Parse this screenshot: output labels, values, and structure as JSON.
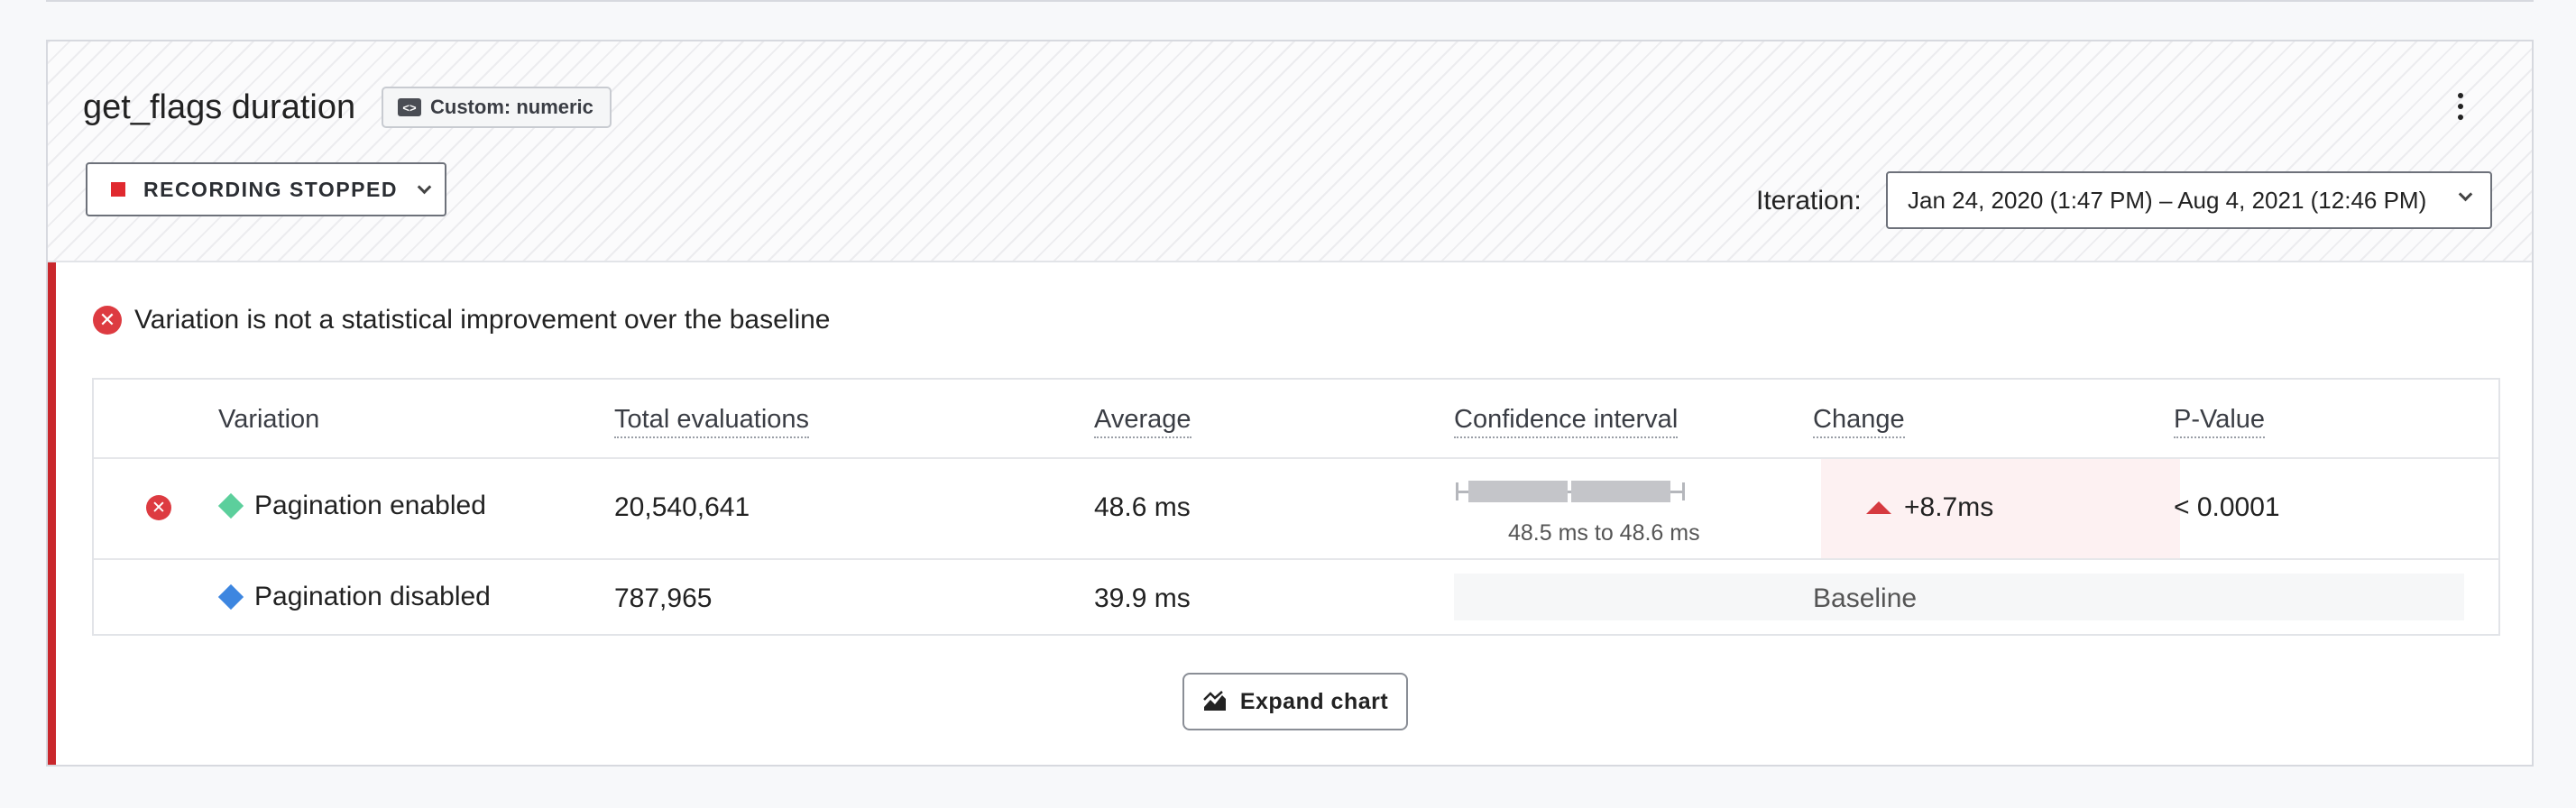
{
  "metric": {
    "title": "get_flags duration",
    "badge": "Custom: numeric",
    "badge_icon": "code-icon"
  },
  "recording": {
    "label": "RECORDING STOPPED",
    "status_color": "#e0292f"
  },
  "iteration": {
    "label": "Iteration:",
    "selected": "Jan 24, 2020 (1:47 PM) – Aug 4, 2021 (12:46 PM)"
  },
  "result": {
    "message": "Variation is not a statistical improvement over the baseline"
  },
  "table": {
    "headers": {
      "variation": "Variation",
      "total": "Total evaluations",
      "average": "Average",
      "ci": "Confidence interval",
      "change": "Change",
      "pvalue": "P-Value"
    },
    "rows": [
      {
        "name": "Pagination enabled",
        "color": "#5ccf9c",
        "total": "20,540,641",
        "average": "48.6 ms",
        "ci_text": "48.5 ms to 48.6 ms",
        "change": "+8.7ms",
        "pvalue": "< 0.0001"
      },
      {
        "name": "Pagination disabled",
        "color": "#3d86e0",
        "total": "787,965",
        "average": "39.9 ms",
        "baseline": "Baseline"
      }
    ]
  },
  "expand": {
    "label": "Expand chart"
  },
  "colors": {
    "accent_red": "#c9272c",
    "fail_red": "#dd3b41"
  }
}
